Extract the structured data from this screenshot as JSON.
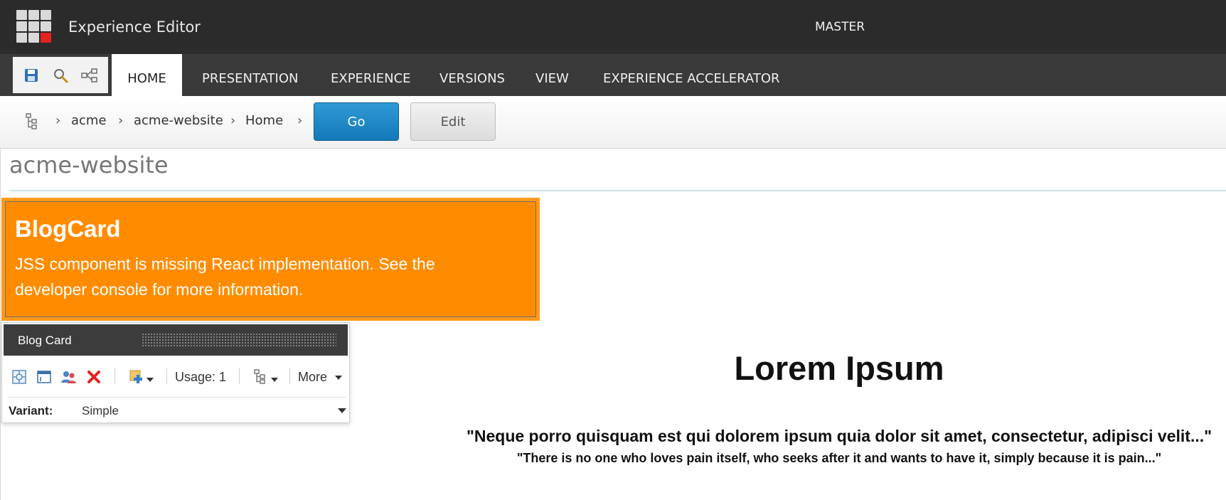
{
  "app": {
    "title": "Experience Editor",
    "database": "MASTER"
  },
  "ribbon": {
    "tabs": [
      {
        "label": "HOME",
        "active": true
      },
      {
        "label": "PRESENTATION",
        "active": false
      },
      {
        "label": "EXPERIENCE",
        "active": false
      },
      {
        "label": "VERSIONS",
        "active": false
      },
      {
        "label": "VIEW",
        "active": false
      },
      {
        "label": "EXPERIENCE ACCELERATOR",
        "active": false
      }
    ],
    "quick_actions": [
      "save-icon",
      "search-icon",
      "share-icon"
    ]
  },
  "breadcrumb": {
    "items": [
      "acme",
      "acme-website",
      "Home"
    ],
    "go_label": "Go",
    "edit_label": "Edit"
  },
  "page": {
    "title": "acme-website"
  },
  "blogcard": {
    "title": "BlogCard",
    "message": "JSS component is missing React implementation. See the developer console for more information."
  },
  "rendering": {
    "name": "Blog Card",
    "usage": "Usage: 1",
    "more_label": "More",
    "variant_label": "Variant:",
    "variant_value": "Simple"
  },
  "content": {
    "heading": "Lorem Ipsum",
    "quote_main": "\"Neque porro quisquam est qui dolorem ipsum quia dolor sit amet, consectetur, adipisci velit...\"",
    "quote_sub": "\"There is no one who loves pain itself, who seeks after it and wants to have it, simply because it is pain...\""
  },
  "colors": {
    "topbar": "#2b2b2b",
    "ribbon": "#3a3a3a",
    "go_button": "#1f88c8",
    "blogcard": "#ff8c00",
    "delete_icon": "#e02424"
  }
}
